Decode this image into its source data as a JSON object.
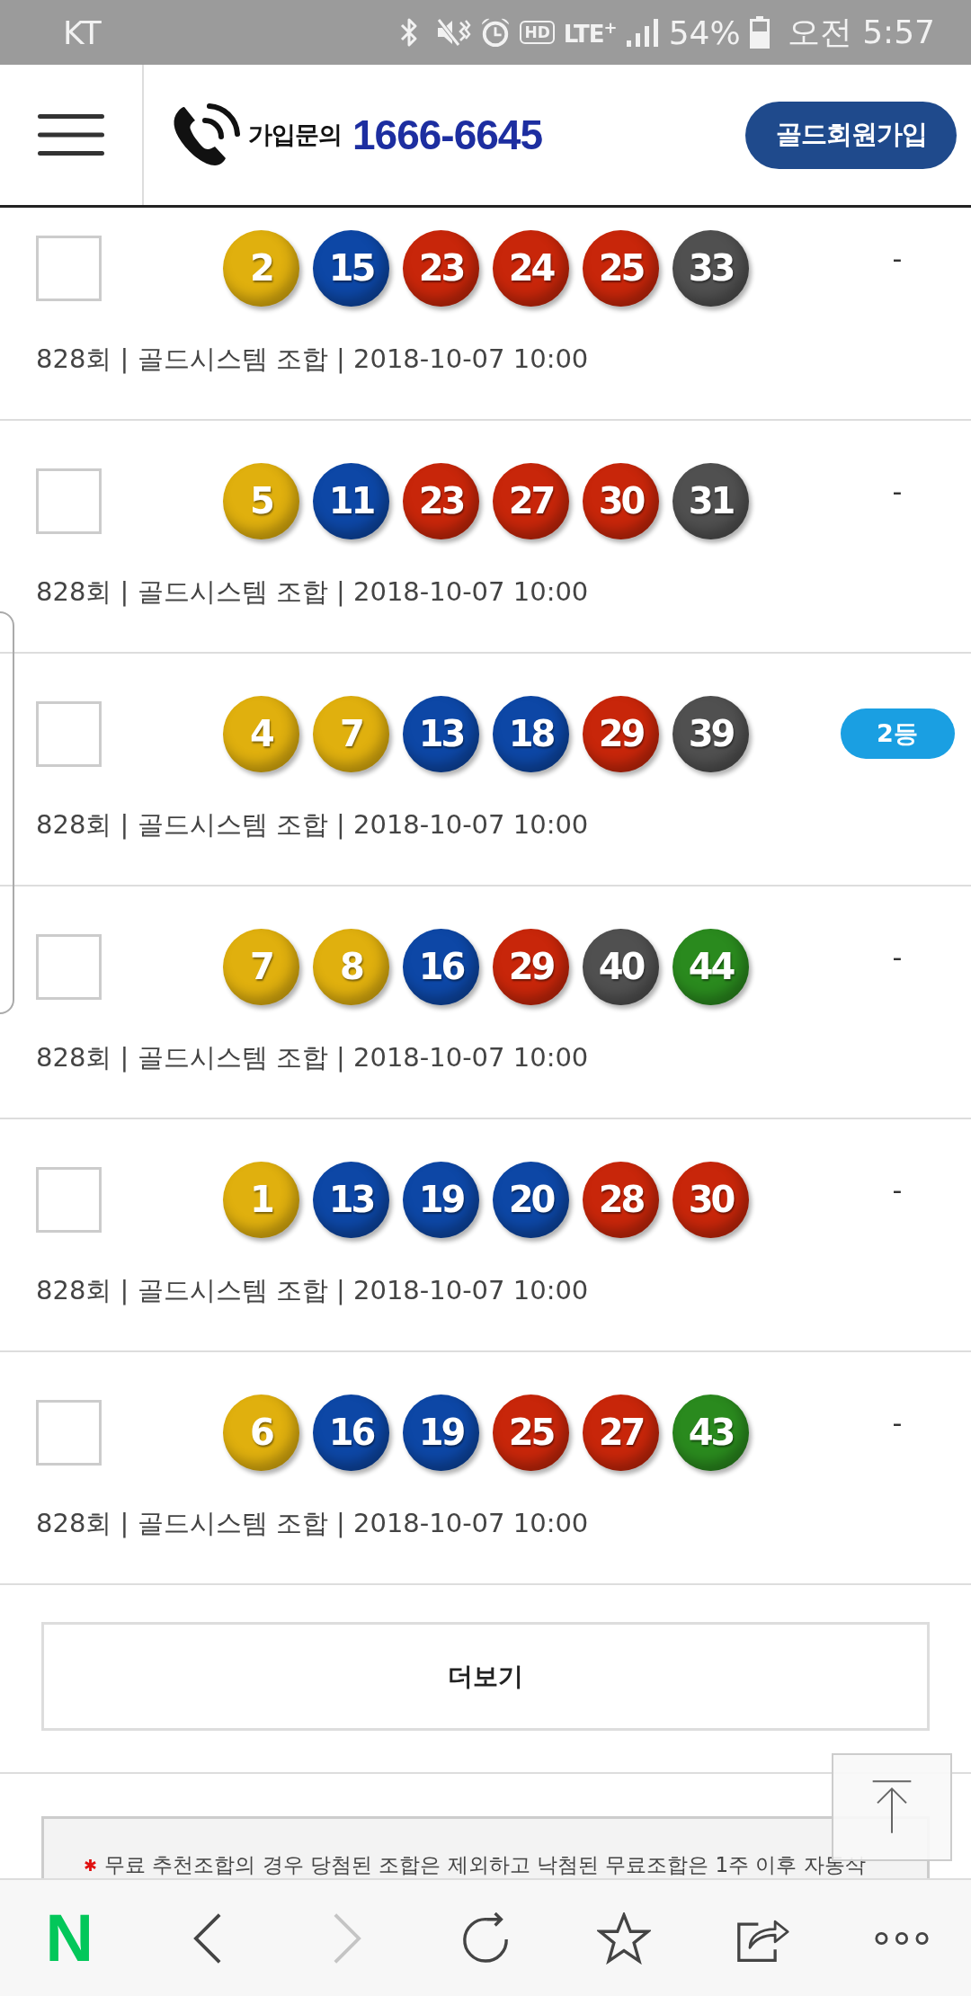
{
  "status_bar": {
    "carrier": "KT",
    "hd": "HD",
    "network": "LTE$^{+}$",
    "battery": "54%",
    "time": "오전 5:57"
  },
  "header": {
    "contact_label": "가입문의",
    "phone": "1666-6645",
    "join_button": "골드회원가입"
  },
  "tickets": [
    {
      "checked": false,
      "balls": [
        {
          "number": "2",
          "color": "#e0b00e"
        },
        {
          "number": "15",
          "color": "#0d47a6"
        },
        {
          "number": "23",
          "color": "#c8260a"
        },
        {
          "number": "24",
          "color": "#c8260a"
        },
        {
          "number": "25",
          "color": "#c8260a"
        },
        {
          "number": "33",
          "color": "#505050"
        }
      ],
      "info": "828회 | 골드시스템 조합 | 2018-10-07 10:00",
      "result": {
        "kind": "none",
        "text": "-"
      }
    },
    {
      "checked": false,
      "balls": [
        {
          "number": "5",
          "color": "#e0b00e"
        },
        {
          "number": "11",
          "color": "#0d47a6"
        },
        {
          "number": "23",
          "color": "#c8260a"
        },
        {
          "number": "27",
          "color": "#c8260a"
        },
        {
          "number": "30",
          "color": "#c8260a"
        },
        {
          "number": "31",
          "color": "#505050"
        }
      ],
      "info": "828회 | 골드시스템 조합 | 2018-10-07 10:00",
      "result": {
        "kind": "none",
        "text": "-"
      }
    },
    {
      "checked": false,
      "balls": [
        {
          "number": "4",
          "color": "#e0b00e"
        },
        {
          "number": "7",
          "color": "#e0b00e"
        },
        {
          "number": "13",
          "color": "#0d47a6"
        },
        {
          "number": "18",
          "color": "#0d47a6"
        },
        {
          "number": "29",
          "color": "#c8260a"
        },
        {
          "number": "39",
          "color": "#505050"
        }
      ],
      "info": "828회 | 골드시스템 조합 | 2018-10-07 10:00",
      "result": {
        "kind": "rank",
        "text": "2등"
      }
    },
    {
      "checked": false,
      "balls": [
        {
          "number": "7",
          "color": "#e0b00e"
        },
        {
          "number": "8",
          "color": "#e0b00e"
        },
        {
          "number": "16",
          "color": "#0d47a6"
        },
        {
          "number": "29",
          "color": "#c8260a"
        },
        {
          "number": "40",
          "color": "#505050"
        },
        {
          "number": "44",
          "color": "#2a8a1e"
        }
      ],
      "info": "828회 | 골드시스템 조합 | 2018-10-07 10:00",
      "result": {
        "kind": "none",
        "text": "-"
      }
    },
    {
      "checked": false,
      "balls": [
        {
          "number": "1",
          "color": "#e0b00e"
        },
        {
          "number": "13",
          "color": "#0d47a6"
        },
        {
          "number": "19",
          "color": "#0d47a6"
        },
        {
          "number": "20",
          "color": "#0d47a6"
        },
        {
          "number": "28",
          "color": "#c8260a"
        },
        {
          "number": "30",
          "color": "#c8260a"
        }
      ],
      "info": "828회 | 골드시스템 조합 | 2018-10-07 10:00",
      "result": {
        "kind": "none",
        "text": "-"
      }
    },
    {
      "checked": false,
      "balls": [
        {
          "number": "6",
          "color": "#e0b00e"
        },
        {
          "number": "16",
          "color": "#0d47a6"
        },
        {
          "number": "19",
          "color": "#0d47a6"
        },
        {
          "number": "25",
          "color": "#c8260a"
        },
        {
          "number": "27",
          "color": "#c8260a"
        },
        {
          "number": "43",
          "color": "#2a8a1e"
        }
      ],
      "info": "828회 | 골드시스템 조합 | 2018-10-07 10:00",
      "result": {
        "kind": "none",
        "text": "-"
      }
    }
  ],
  "more_button": "더보기",
  "notice": {
    "text": "무료 추천조합의 경우 당첨된 조합은 제외하고 낙첨된 무료조합은 1주 이후 자동삭"
  },
  "browser_toolbar": [
    {
      "kind": "logo",
      "label": "N",
      "disabled": false
    },
    {
      "kind": "back",
      "disabled": false
    },
    {
      "kind": "forward",
      "disabled": true
    },
    {
      "kind": "reload",
      "disabled": false
    },
    {
      "kind": "bookmark",
      "disabled": false
    },
    {
      "kind": "share",
      "disabled": false
    },
    {
      "kind": "more",
      "disabled": false
    }
  ]
}
